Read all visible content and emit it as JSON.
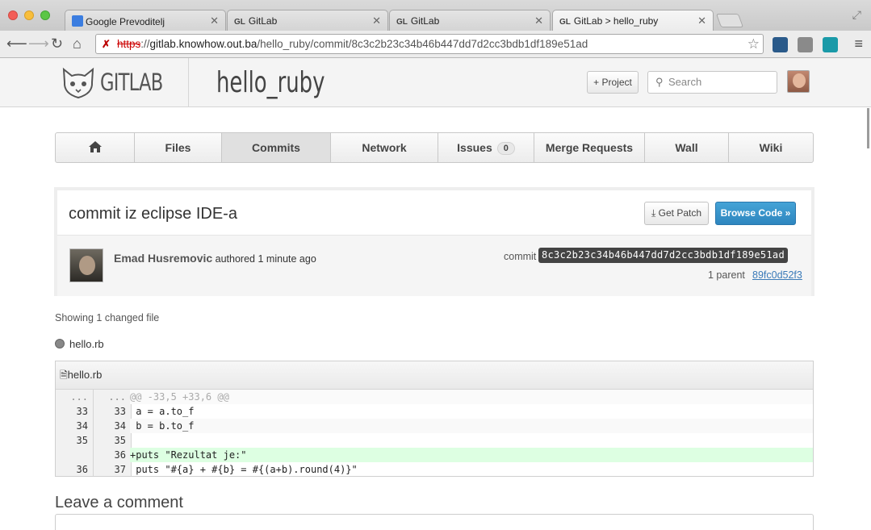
{
  "browser": {
    "tabs": [
      {
        "title": "Google Prevoditelj",
        "favicon": "google-translate-icon"
      },
      {
        "title": "GitLab",
        "favicon": "gitlab-icon",
        "badge": "GL"
      },
      {
        "title": "GitLab",
        "favicon": "gitlab-icon",
        "badge": "GL"
      },
      {
        "title": "GitLab > hello_ruby",
        "favicon": "gitlab-icon",
        "badge": "GL"
      }
    ],
    "url": {
      "scheme": "https",
      "rest": "://",
      "host": "gitlab.knowhow.out.ba",
      "path": "/hello_ruby/commit/8c3c2b23c34b46b447dd7d2cc3bdb1df189e51ad"
    }
  },
  "header": {
    "logo_text": "GITLAB",
    "project_name": "hello_ruby",
    "project_button": "+ Project",
    "search_placeholder": "Search"
  },
  "nav": {
    "tabs": [
      {
        "label": "",
        "icon": "home-icon"
      },
      {
        "label": "Files"
      },
      {
        "label": "Commits",
        "active": true
      },
      {
        "label": "Network"
      },
      {
        "label": "Issues",
        "count": "0"
      },
      {
        "label": "Merge Requests"
      },
      {
        "label": "Wall"
      },
      {
        "label": "Wiki"
      }
    ]
  },
  "commit": {
    "title": "commit iz eclipse IDE-a",
    "get_patch": "Get Patch",
    "browse_code": "Browse Code »",
    "author": "Emad Husremovic",
    "authored": "authored",
    "time": "1 minute ago",
    "commit_label": "commit",
    "sha": "8c3c2b23c34b46b447dd7d2cc3bdb1df189e51ad",
    "parent_label": "1 parent",
    "parent_sha": "89fc0d52f3"
  },
  "changes": {
    "showing": "Showing 1 changed file",
    "file": "hello.rb"
  },
  "diff": {
    "filename": "hello.rb",
    "rows": [
      {
        "old": "...",
        "new": "...",
        "text": "@@ -33,5 +33,6 @@",
        "kind": "hunk"
      },
      {
        "old": "33",
        "new": "33",
        "text": " a = a.to_f",
        "kind": "ctx"
      },
      {
        "old": "34",
        "new": "34",
        "text": " b = b.to_f",
        "kind": "ctx"
      },
      {
        "old": "35",
        "new": "35",
        "text": "",
        "kind": "ctx"
      },
      {
        "old": "",
        "new": "36",
        "text": "+puts \"Rezultat je:\"",
        "kind": "add"
      },
      {
        "old": "36",
        "new": "37",
        "text": " puts \"#{a} + #{b} = #{(a+b).round(4)}\"",
        "kind": "ctx"
      }
    ]
  },
  "comment": {
    "heading": "Leave a comment"
  },
  "colors": {
    "accent": "#2e86bf",
    "diff_add": "#ddffe2"
  }
}
